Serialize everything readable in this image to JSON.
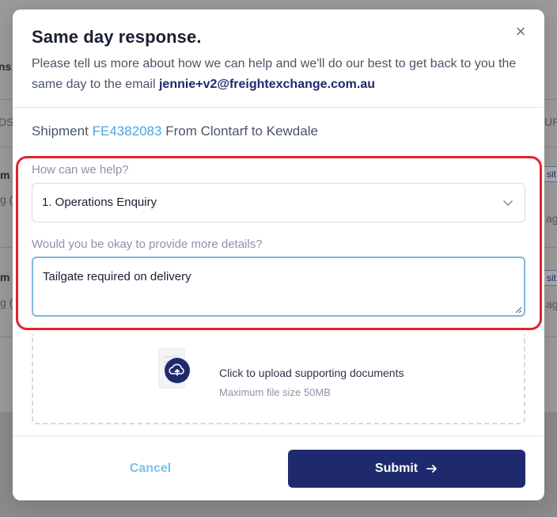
{
  "background": {
    "fragments": [
      "ns E",
      "DS",
      "m",
      "g (",
      "m",
      "g (",
      "UP",
      "sit",
      "age",
      "sit",
      "age"
    ]
  },
  "modal": {
    "title": "Same day response.",
    "description": "Please tell us more about how we can help and we'll do our best to get back to you the same day to the email",
    "email": "jennie+v2@freightexchange.com.au",
    "shipment": {
      "prefix": "Shipment",
      "id": "FE4382083",
      "route": "From Clontarf to Kewdale"
    },
    "help_field": {
      "label": "How can we help?",
      "selected": "1. Operations Enquiry"
    },
    "details_field": {
      "label": "Would you be okay to provide more details?",
      "value": "Tailgate required on delivery"
    },
    "upload": {
      "title": "Click to upload supporting documents",
      "subtitle": "Maximum file size 50MB"
    },
    "actions": {
      "cancel": "Cancel",
      "submit": "Submit"
    },
    "close_symbol": "×"
  },
  "colors": {
    "primary": "#1f2a6e",
    "link": "#4aa3df",
    "highlight": "#e0242f",
    "focus_border": "#7fb7de"
  },
  "icons": {
    "close": "close-icon",
    "chevron": "chevron-down-icon",
    "upload": "cloud-upload-icon",
    "submit": "arrow-right-icon"
  }
}
